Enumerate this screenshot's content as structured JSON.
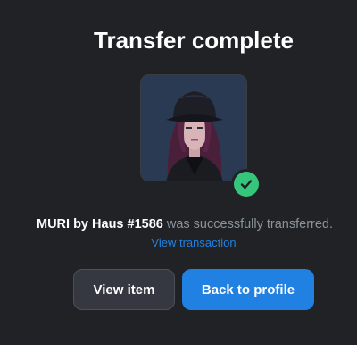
{
  "modal": {
    "title": "Transfer complete",
    "item_name": "MURI by Haus #1586",
    "message_suffix": " was successfully transferred.",
    "view_transaction_label": "View transaction",
    "view_item_label": "View item",
    "back_to_profile_label": "Back to profile"
  },
  "icons": {
    "status": "check-circle-icon"
  },
  "colors": {
    "background": "#202225",
    "accent": "#2081e2",
    "success": "#34c77b",
    "muted_text": "#8a939b",
    "secondary_button": "#353840"
  }
}
